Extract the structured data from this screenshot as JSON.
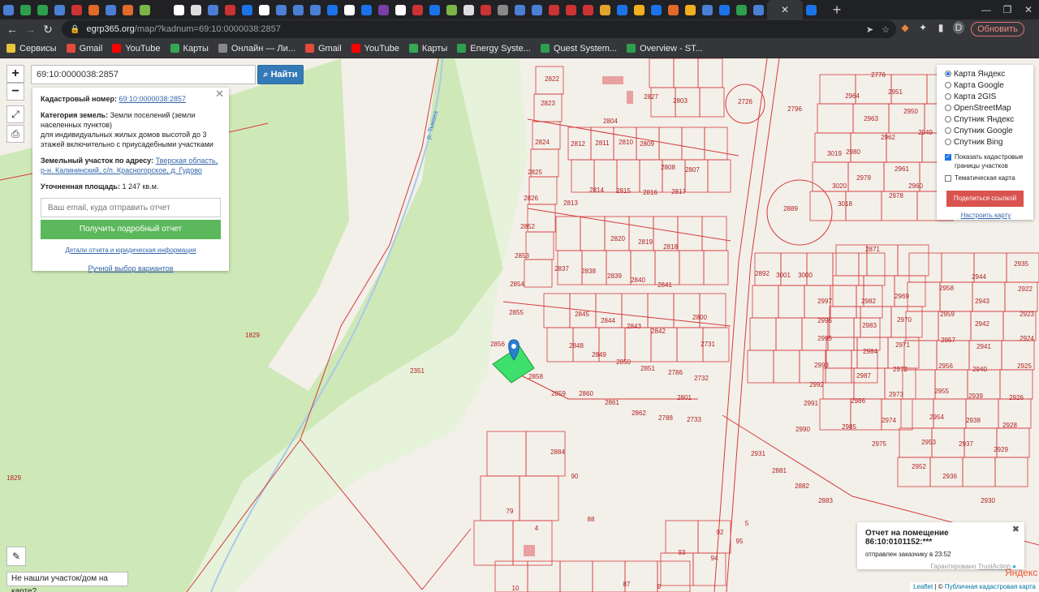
{
  "browser": {
    "url_host": "egrp365.org",
    "url_path": "/map/?kadnum=69:10:0000038:2857",
    "update_label": "Обновить",
    "avatar_letter": "D",
    "tab_icon_colors": [
      "#4a7fd4",
      "#2e9e4f",
      "#2e9e4f",
      "#4a7fd4",
      "#cc3333",
      "#e26a2c",
      "#4a7fd4",
      "#e26a2c",
      "#7ab648",
      "#222222",
      "#ffffff",
      "#dddddd",
      "#4a7fd4",
      "#cc3333",
      "#1a73e8",
      "#ffffff",
      "#4a7fd4",
      "#4a7fd4",
      "#4a7fd4",
      "#1a73e8",
      "#ffffff",
      "#1a73e8",
      "#7a3fa8",
      "#ffffff",
      "#cc3333",
      "#1a73e8",
      "#7ab648",
      "#dddddd",
      "#cc3333",
      "#888888",
      "#4a7fd4",
      "#4a7fd4",
      "#cc3333",
      "#cc3333",
      "#cc3333",
      "#e2a32c",
      "#1a73e8",
      "#f2b01e",
      "#1a73e8",
      "#e26a2c",
      "#f2b01e",
      "#4a7fd4",
      "#1a73e8",
      "#2e9e4f",
      "#4a7fd4",
      "#1a73e8"
    ]
  },
  "bookmarks": [
    {
      "label": "Сервисы",
      "color": "#e8c53a"
    },
    {
      "label": "Gmail",
      "color": "#e44b3a"
    },
    {
      "label": "YouTube",
      "color": "#ff0000"
    },
    {
      "label": "Карты",
      "color": "#34a853"
    },
    {
      "label": "Онлайн — Ли...",
      "color": "#888888"
    },
    {
      "label": "Gmail",
      "color": "#e44b3a"
    },
    {
      "label": "YouTube",
      "color": "#ff0000"
    },
    {
      "label": "Карты",
      "color": "#34a853"
    },
    {
      "label": "Energy Syste...",
      "color": "#2e9e4f"
    },
    {
      "label": "Quest System...",
      "color": "#2e9e4f"
    },
    {
      "label": "Overview - ST...",
      "color": "#2e9e4f"
    }
  ],
  "map": {
    "zoom_in": "+",
    "zoom_out": "−",
    "search_value": "69:10:0000038:2857",
    "search_button": "Найти",
    "labels_parcels": [
      {
        "t": "2822"
      },
      {
        "t": "2823"
      },
      {
        "t": "2824"
      },
      {
        "t": "2825"
      },
      {
        "t": "2826"
      },
      {
        "t": "2852"
      },
      {
        "t": "2853"
      },
      {
        "t": "2854"
      },
      {
        "t": "2855"
      },
      {
        "t": "2856"
      },
      {
        "t": "2858"
      },
      {
        "t": "2859"
      },
      {
        "t": "2860"
      },
      {
        "t": "2861"
      },
      {
        "t": "2862"
      },
      {
        "t": "2788"
      },
      {
        "t": "2733"
      },
      {
        "t": "2351"
      },
      {
        "t": "1829"
      },
      {
        "t": "1829"
      },
      {
        "t": "2827"
      },
      {
        "t": "2803"
      },
      {
        "t": "2804"
      },
      {
        "t": "2812"
      },
      {
        "t": "2811"
      },
      {
        "t": "2810"
      },
      {
        "t": "2809"
      },
      {
        "t": "2808"
      },
      {
        "t": "2807"
      },
      {
        "t": "2814"
      },
      {
        "t": "2815"
      },
      {
        "t": "2816"
      },
      {
        "t": "2817"
      },
      {
        "t": "2813"
      },
      {
        "t": "2820"
      },
      {
        "t": "2819"
      },
      {
        "t": "2818"
      },
      {
        "t": "2837"
      },
      {
        "t": "2838"
      },
      {
        "t": "2839"
      },
      {
        "t": "2840"
      },
      {
        "t": "2841"
      },
      {
        "t": "2845"
      },
      {
        "t": "2844"
      },
      {
        "t": "2843"
      },
      {
        "t": "2842"
      },
      {
        "t": "2848"
      },
      {
        "t": "2849"
      },
      {
        "t": "2850"
      },
      {
        "t": "2851"
      },
      {
        "t": "2786"
      },
      {
        "t": "2732"
      },
      {
        "t": "2801"
      },
      {
        "t": "2800"
      },
      {
        "t": "2731"
      },
      {
        "t": "2726"
      },
      {
        "t": "2796"
      },
      {
        "t": "2889"
      },
      {
        "t": "2871"
      },
      {
        "t": "3019"
      },
      {
        "t": "3020"
      },
      {
        "t": "3018"
      },
      {
        "t": "2978"
      },
      {
        "t": "2980"
      },
      {
        "t": "2979"
      },
      {
        "t": "2964"
      },
      {
        "t": "2963"
      },
      {
        "t": "2962"
      },
      {
        "t": "2961"
      },
      {
        "t": "2960"
      },
      {
        "t": "2951"
      },
      {
        "t": "2950"
      },
      {
        "t": "2949"
      },
      {
        "t": "2776"
      },
      {
        "t": "2892"
      },
      {
        "t": "3001"
      },
      {
        "t": "3000"
      },
      {
        "t": "2997"
      },
      {
        "t": "2996"
      },
      {
        "t": "2995"
      },
      {
        "t": "2993"
      },
      {
        "t": "2992"
      },
      {
        "t": "2991"
      },
      {
        "t": "2990"
      },
      {
        "t": "2982"
      },
      {
        "t": "2983"
      },
      {
        "t": "2984"
      },
      {
        "t": "2987"
      },
      {
        "t": "2986"
      },
      {
        "t": "2985"
      },
      {
        "t": "2969"
      },
      {
        "t": "2970"
      },
      {
        "t": "2971"
      },
      {
        "t": "2972"
      },
      {
        "t": "2973"
      },
      {
        "t": "2974"
      },
      {
        "t": "2975"
      },
      {
        "t": "2958"
      },
      {
        "t": "2959"
      },
      {
        "t": "2957"
      },
      {
        "t": "2956"
      },
      {
        "t": "2955"
      },
      {
        "t": "2954"
      },
      {
        "t": "2953"
      },
      {
        "t": "2952"
      },
      {
        "t": "2944"
      },
      {
        "t": "2943"
      },
      {
        "t": "2942"
      },
      {
        "t": "2941"
      },
      {
        "t": "2940"
      },
      {
        "t": "2939"
      },
      {
        "t": "2938"
      },
      {
        "t": "2937"
      },
      {
        "t": "2936"
      },
      {
        "t": "2935"
      },
      {
        "t": "2922"
      },
      {
        "t": "2923"
      },
      {
        "t": "2924"
      },
      {
        "t": "2925"
      },
      {
        "t": "2926"
      },
      {
        "t": "2928"
      },
      {
        "t": "2929"
      },
      {
        "t": "2930"
      },
      {
        "t": "2931"
      },
      {
        "t": "2881"
      },
      {
        "t": "2882"
      },
      {
        "t": "2883"
      },
      {
        "t": "2884"
      },
      {
        "t": "90"
      },
      {
        "t": "88"
      },
      {
        "t": "79"
      },
      {
        "t": "4"
      },
      {
        "t": "5"
      },
      {
        "t": "92"
      },
      {
        "t": "95"
      },
      {
        "t": "94"
      },
      {
        "t": "93"
      },
      {
        "t": "87"
      },
      {
        "t": "9"
      },
      {
        "t": "10"
      },
      {
        "t": "43"
      }
    ],
    "street_label": "р. Тьмака"
  },
  "info_panel": {
    "cadastral_label": "Кадастровый номер:",
    "cadastral_value": "69:10:0000038:2857",
    "category_label": "Категория земель:",
    "category_value": "Земли поселений (земли населенных пунктов)",
    "category_desc": "для индивидуальных жилых домов высотой до 3 этажей включительно с приусадебными участками",
    "address_label": "Земельный участок по адресу:",
    "address_value": "Тверская область, р-н. Калининский, с/п. Красногорское, д. Гудово",
    "area_label": "Уточненная площадь:",
    "area_value": "1 247 кв.м.",
    "email_placeholder": "Ваш email, куда отправить отчет",
    "report_button": "Получить подробный отчет",
    "details_link": "Детали отчета и юридическая информация",
    "manual_link": "Ручной выбор вариантов"
  },
  "layers": {
    "options": [
      "Карта Яндекс",
      "Карта Google",
      "Карта 2GIS",
      "OpenStreetMap",
      "Спутник Яндекс",
      "Спутник Google",
      "Спутник Bing"
    ],
    "selected": "Карта Яндекс",
    "show_borders": "Показать кадастровые границы участков",
    "show_borders_checked": true,
    "thematic": "Тематическая карта",
    "thematic_checked": false,
    "share_button": "Поделиться ссылкой",
    "customize_link": "Настроить карту"
  },
  "not_found_button": "Не нашли участок/дом на карте?",
  "toast": {
    "title": "Отчет на помещение 86:10:0101152:***",
    "subtitle": "отправлен заказчику в 23:52",
    "guarantee": "Гарантировано",
    "brand": "TrustAction"
  },
  "yandex_logo": "Яндекс",
  "attribution": {
    "leaflet": "Leaflet",
    "sep": " | © ",
    "source": "Публичная кадастровая карта"
  },
  "colors": {
    "parcel_line": "#d63b3b",
    "forest": "#cfe8b8",
    "selected_parcel": "#3ee06b",
    "marker": "#2a7fd1"
  }
}
